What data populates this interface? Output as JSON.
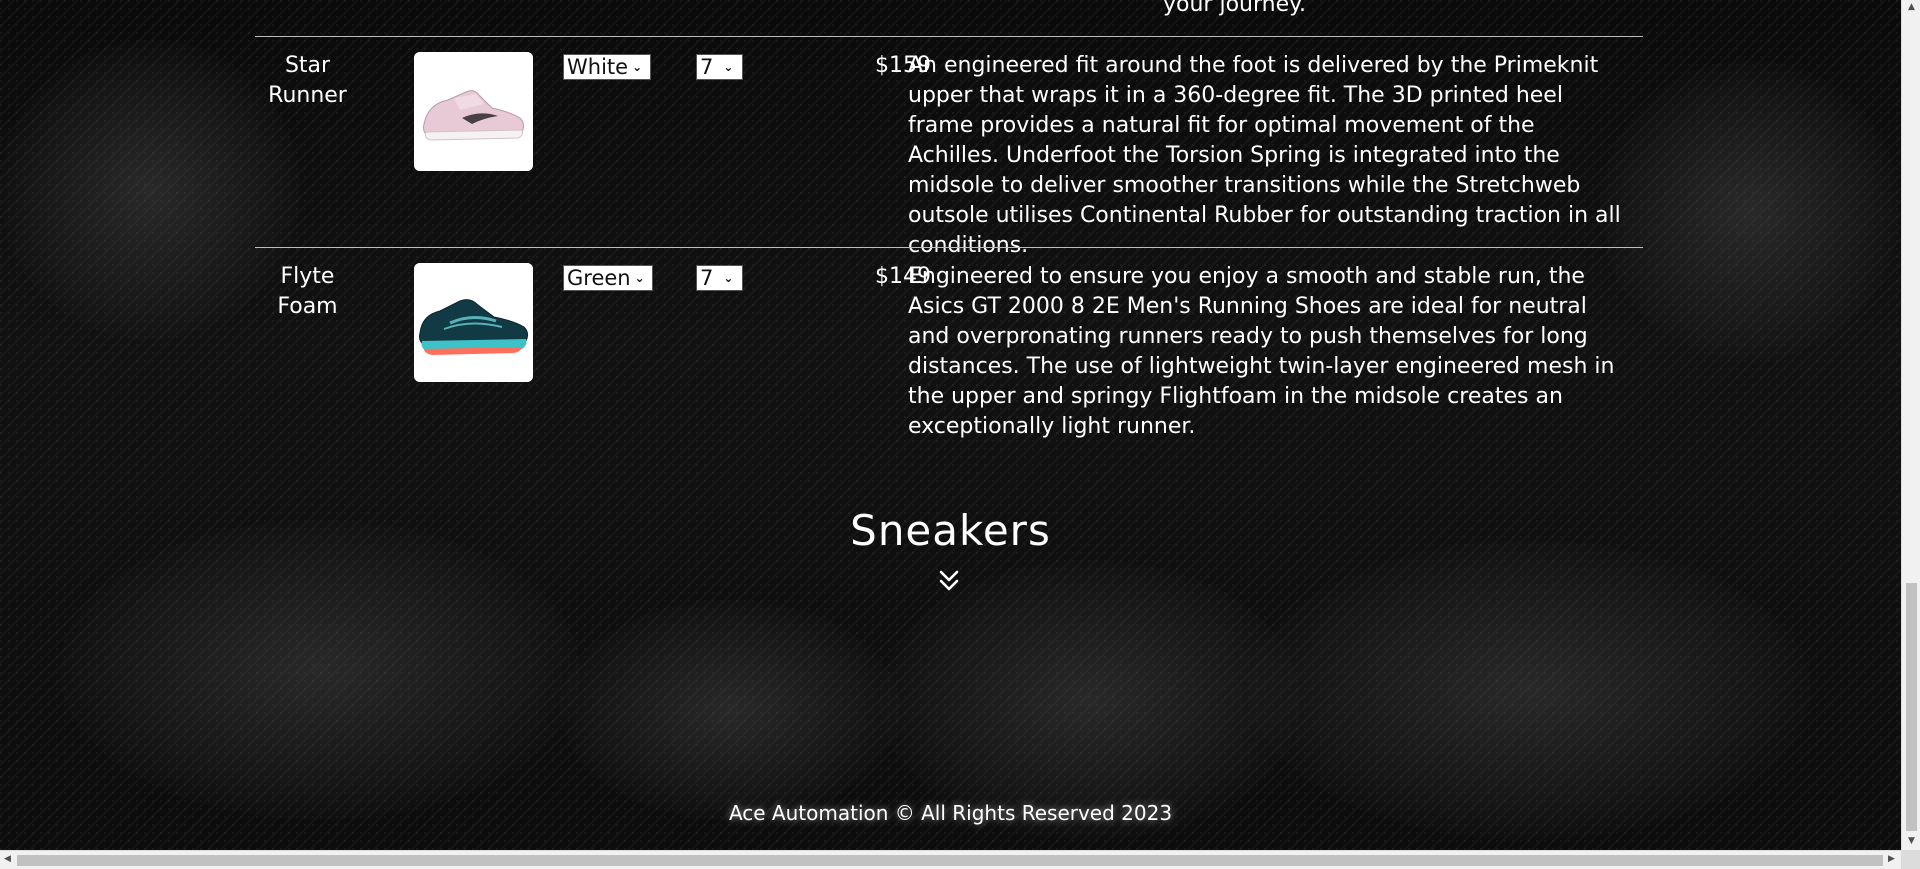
{
  "product_table": {
    "previous_row_tail": "your journey.",
    "rows": [
      {
        "name": "Star Runner",
        "image_icon": "pink-sneaker-image",
        "color": "White",
        "size": "7",
        "price": "$159",
        "description": "An engineered fit around the foot is delivered by the Primeknit upper that wraps it in a 360-degree fit. The 3D printed heel frame provides a natural fit for optimal movement of the Achilles. Underfoot the Torsion Spring is integrated into the midsole to deliver smoother transitions while the Stretchweb outsole utilises Continental Rubber for outstanding traction in all conditions."
      },
      {
        "name": "Flyte Foam",
        "image_icon": "teal-running-shoe-image",
        "color": "Green",
        "size": "7",
        "price": "$149",
        "description": "Engineered to ensure you enjoy a smooth and stable run, the Asics GT 2000 8 2E Men's Running Shoes are ideal for neutral and overpronating runners ready to push themselves for long distances. The use of lightweight twin-layer engineered mesh in the upper and springy Flightfoam in the midsole creates an exceptionally light runner."
      }
    ]
  },
  "section": {
    "title": "Sneakers",
    "expand_icon": "double-chevron-down-icon"
  },
  "footer": {
    "text": "Ace Automation © All Rights Reserved 2023"
  },
  "colors": {
    "background": "#050505",
    "text": "#ffffff",
    "divider": "#bdbdbd",
    "scrollbar_track": "#f1f1f1",
    "scrollbar_thumb": "#c1c1c1"
  }
}
